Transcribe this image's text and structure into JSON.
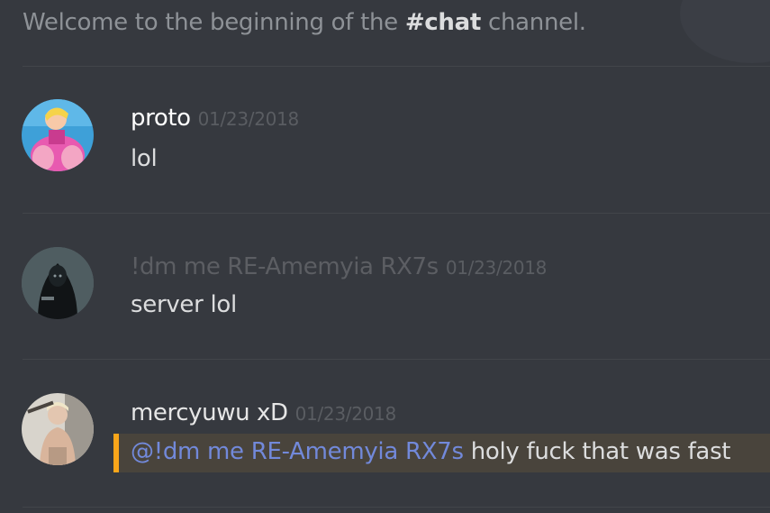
{
  "welcome": {
    "prefix": "Welcome to the beginning of the ",
    "channel": "#chat",
    "suffix": " channel."
  },
  "messages": [
    {
      "author": "proto",
      "timestamp": "01/23/2018",
      "text": "lol"
    },
    {
      "author": "!dm me RE-Amemyia RX7s",
      "timestamp": "01/23/2018",
      "text": "server lol"
    },
    {
      "author": "mercyuwu xD",
      "timestamp": "01/23/2018",
      "mention": "@!dm me RE-Amemyia RX7s",
      "text": " holy fuck that was fast"
    }
  ],
  "colors": {
    "background": "#36393f",
    "mention_text": "#7289da",
    "mention_highlight": "#49443c",
    "mention_bar": "#faa61a"
  }
}
